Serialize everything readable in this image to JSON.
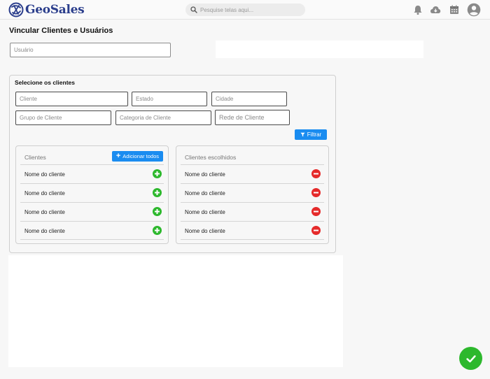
{
  "header": {
    "brand": "GeoSales",
    "search_placeholder": "Pesquise telas aqui...",
    "icons": [
      "bell-icon",
      "cloud-download-icon",
      "calendar-icon",
      "user-avatar-icon"
    ]
  },
  "page": {
    "title": "Vincular Clientes e Usuários",
    "user_field_placeholder": "Usuário"
  },
  "filters": {
    "title": "Selecione os clientes",
    "cliente_placeholder": "Cliente",
    "estado_placeholder": "Estado",
    "cidade_placeholder": "Cidade",
    "grupo_placeholder": "Grupo de Cliente",
    "categoria_placeholder": "Categoria de Cliente",
    "rede_placeholder": "Rede de Cliente",
    "filter_button": "Filtrar"
  },
  "clients_list": {
    "title": "Clientes",
    "add_all_button": "Adicionar todos",
    "items": [
      "Nome do cliente",
      "Nome do cliente",
      "Nome do cliente",
      "Nome do cliente"
    ]
  },
  "chosen_list": {
    "title": "Clientes escolhidos",
    "items": [
      "Nome do cliente",
      "Nome do cliente",
      "Nome do cliente",
      "Nome do cliente"
    ]
  },
  "colors": {
    "primary": "#1a8cf0",
    "add": "#2db82d",
    "remove": "#e52a2a",
    "brand": "#2b3e8c"
  }
}
